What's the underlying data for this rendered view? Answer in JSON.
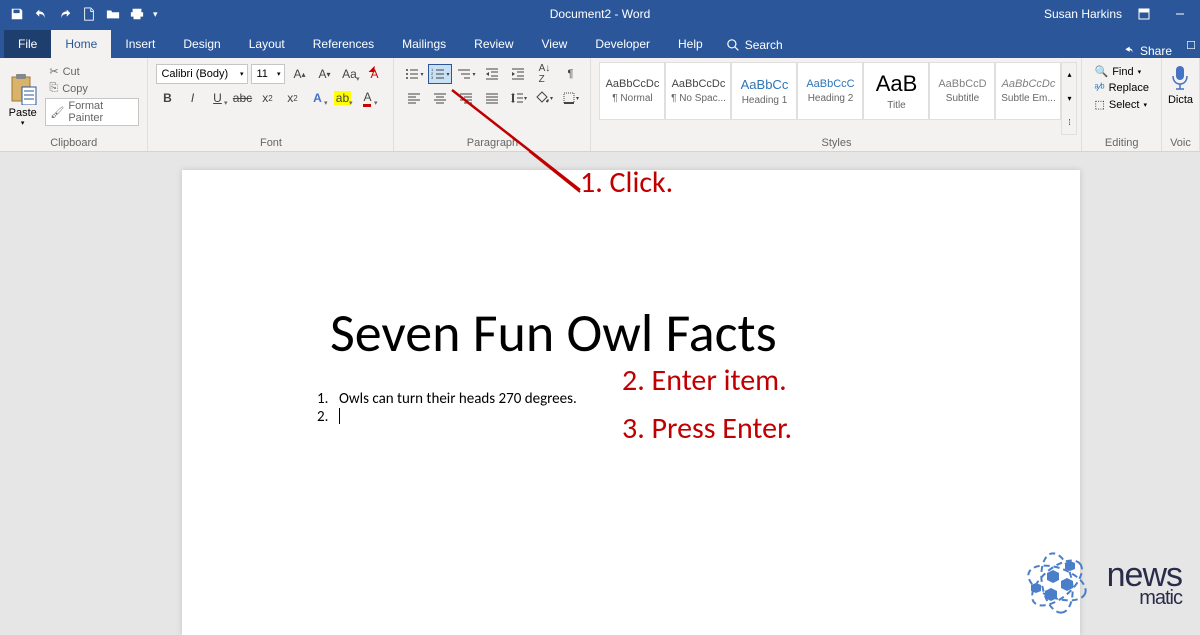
{
  "titlebar": {
    "title": "Document2 - Word",
    "user": "Susan Harkins"
  },
  "tabs": {
    "file": "File",
    "home": "Home",
    "insert": "Insert",
    "design": "Design",
    "layout": "Layout",
    "references": "References",
    "mailings": "Mailings",
    "review": "Review",
    "view": "View",
    "developer": "Developer",
    "help": "Help",
    "search": "Search",
    "share": "Share"
  },
  "ribbon": {
    "clipboard": {
      "label": "Clipboard",
      "paste": "Paste",
      "cut": "Cut",
      "copy": "Copy",
      "format_painter": "Format Painter"
    },
    "font": {
      "label": "Font",
      "name": "Calibri (Body)",
      "size": "11"
    },
    "paragraph": {
      "label": "Paragraph"
    },
    "styles": {
      "label": "Styles",
      "items": [
        {
          "preview": "AaBbCcDc",
          "name": "¶ Normal"
        },
        {
          "preview": "AaBbCcDc",
          "name": "¶ No Spac..."
        },
        {
          "preview": "AaBbCc",
          "name": "Heading 1"
        },
        {
          "preview": "AaBbCcC",
          "name": "Heading 2"
        },
        {
          "preview": "AaB",
          "name": "Title"
        },
        {
          "preview": "AaBbCcD",
          "name": "Subtitle"
        },
        {
          "preview": "AaBbCcDc",
          "name": "Subtle Em..."
        }
      ]
    },
    "editing": {
      "label": "Editing",
      "find": "Find",
      "replace": "Replace",
      "select": "Select"
    },
    "voice": "Voic",
    "dictate": "Dicta"
  },
  "document": {
    "title": "Seven Fun Owl Facts",
    "list": {
      "num1": "1.",
      "item1": "Owls can turn their heads 270 degrees.",
      "num2": "2."
    }
  },
  "annotations": {
    "a1": "1. Click.",
    "a2": "2. Enter item.",
    "a3": "3. Press Enter."
  },
  "logo": {
    "top": "news",
    "bottom": "matic"
  }
}
